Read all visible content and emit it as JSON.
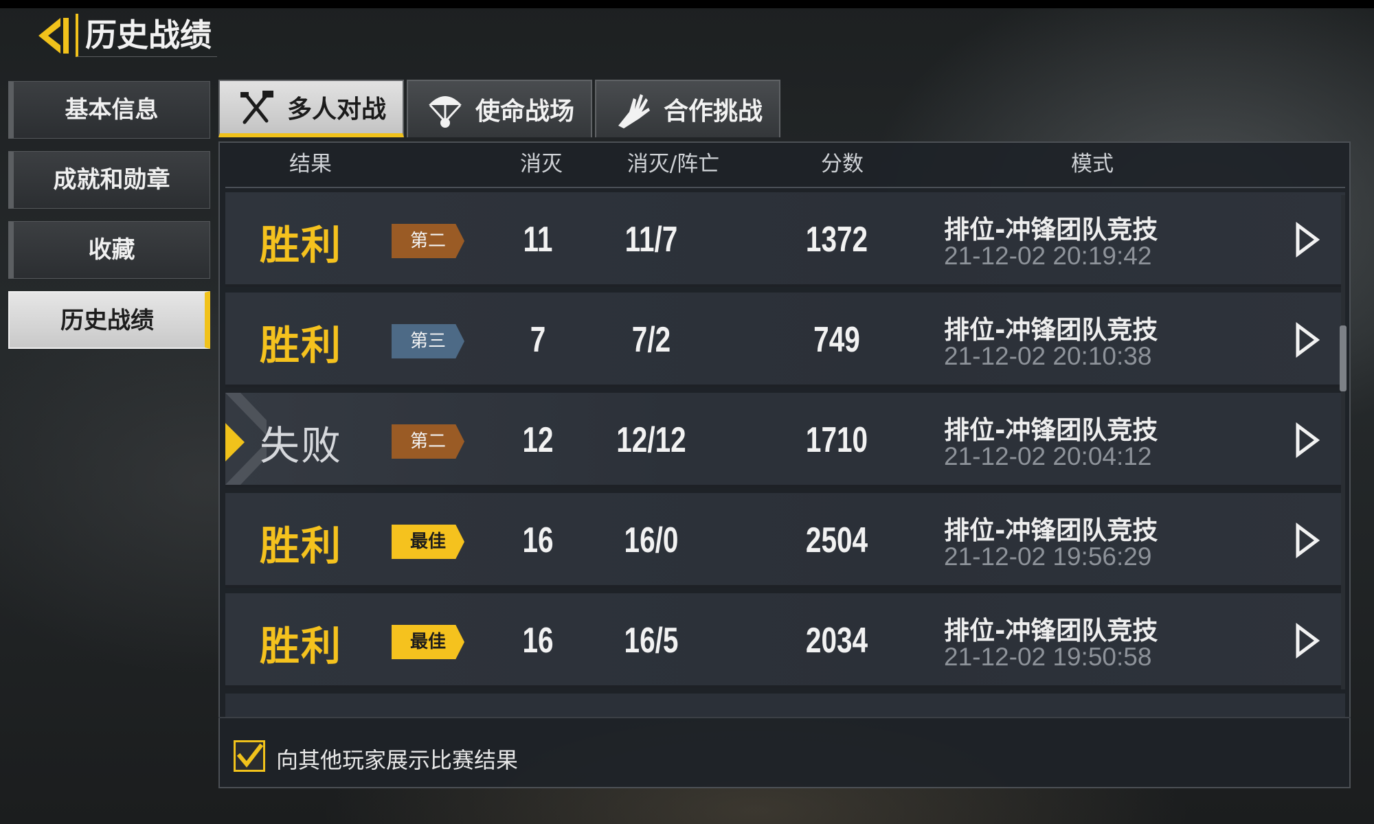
{
  "header": {
    "title": "历史战绩"
  },
  "sidebar": {
    "items": [
      {
        "label": "基本信息",
        "active": false
      },
      {
        "label": "成就和勋章",
        "active": false
      },
      {
        "label": "收藏",
        "active": false
      },
      {
        "label": "历史战绩",
        "active": true
      }
    ]
  },
  "tabs": [
    {
      "label": "多人对战",
      "icon": "crossed-weapons-icon",
      "active": true
    },
    {
      "label": "使命战场",
      "icon": "parachute-icon",
      "active": false
    },
    {
      "label": "合作挑战",
      "icon": "zombie-hand-icon",
      "active": false
    }
  ],
  "table": {
    "columns": [
      "结果",
      "消灭",
      "消灭/阵亡",
      "分数",
      "模式"
    ],
    "rows": [
      {
        "result": "胜利",
        "badge": "第二",
        "badge_type": "2",
        "kills": "11",
        "kd": "11/7",
        "score": "1372",
        "mode": "排位-冲锋团队竞技",
        "time": "21-12-02 20:19:42"
      },
      {
        "result": "胜利",
        "badge": "第三",
        "badge_type": "3",
        "kills": "7",
        "kd": "7/2",
        "score": "749",
        "mode": "排位-冲锋团队竞技",
        "time": "21-12-02 20:10:38"
      },
      {
        "result": "失败",
        "badge": "第二",
        "badge_type": "2",
        "kills": "12",
        "kd": "12/12",
        "score": "1710",
        "mode": "排位-冲锋团队竞技",
        "time": "21-12-02 20:04:12"
      },
      {
        "result": "胜利",
        "badge": "最佳",
        "badge_type": "best",
        "kills": "16",
        "kd": "16/0",
        "score": "2504",
        "mode": "排位-冲锋团队竞技",
        "time": "21-12-02 19:56:29"
      },
      {
        "result": "胜利",
        "badge": "最佳",
        "badge_type": "best",
        "kills": "16",
        "kd": "16/5",
        "score": "2034",
        "mode": "排位-冲锋团队竞技",
        "time": "21-12-02 19:50:58"
      }
    ],
    "partial_row_mode": "排位-冲锋团队竞技"
  },
  "footer": {
    "show_results_checked": true,
    "show_results_label": "向其他玩家展示比赛结果"
  },
  "colors": {
    "accent": "#f1c21b",
    "badge_second": "#9a5b25",
    "badge_third": "#4d6a86",
    "badge_best": "#f5c21e"
  }
}
